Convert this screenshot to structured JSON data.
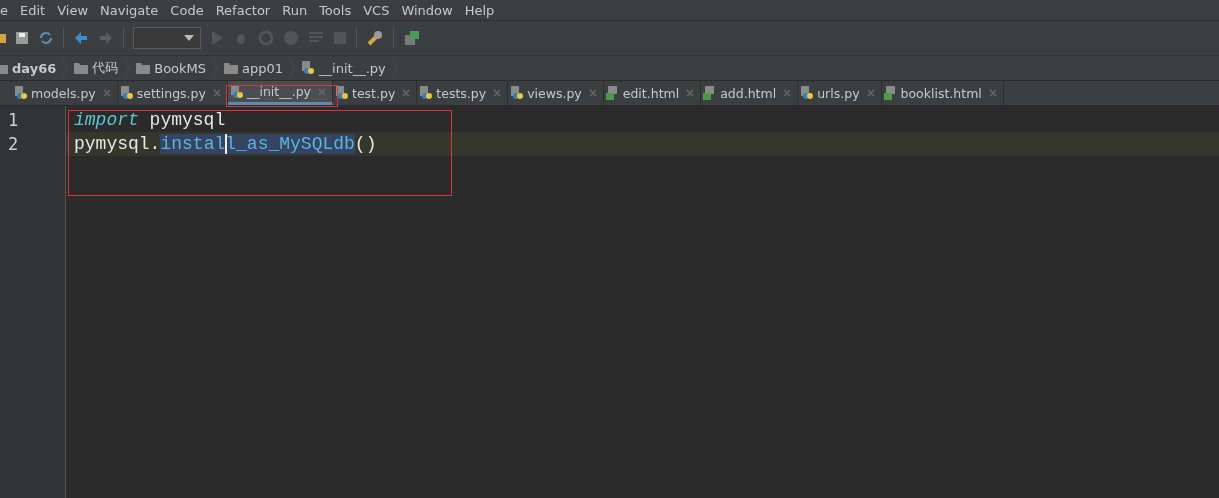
{
  "menu": [
    "e",
    "Edit",
    "View",
    "Navigate",
    "Code",
    "Refactor",
    "Run",
    "Tools",
    "VCS",
    "Window",
    "Help"
  ],
  "breadcrumbs": [
    {
      "label": "day66",
      "kind": "project"
    },
    {
      "label": "代码",
      "kind": "folder"
    },
    {
      "label": "BookMS",
      "kind": "folder"
    },
    {
      "label": "app01",
      "kind": "folder"
    },
    {
      "label": "__init__.py",
      "kind": "python"
    }
  ],
  "tabs": [
    {
      "label": "models.py",
      "kind": "python",
      "selected": false
    },
    {
      "label": "settings.py",
      "kind": "python",
      "selected": false
    },
    {
      "label": "__init__.py",
      "kind": "python",
      "selected": true
    },
    {
      "label": "test.py",
      "kind": "python",
      "selected": false
    },
    {
      "label": "tests.py",
      "kind": "python",
      "selected": false
    },
    {
      "label": "views.py",
      "kind": "python",
      "selected": false
    },
    {
      "label": "edit.html",
      "kind": "html",
      "selected": false
    },
    {
      "label": "add.html",
      "kind": "html",
      "selected": false
    },
    {
      "label": "urls.py",
      "kind": "python",
      "selected": false
    },
    {
      "label": "booklist.html",
      "kind": "html",
      "selected": false
    }
  ],
  "editor": {
    "lines": [
      {
        "number": "1",
        "current": false,
        "tokens": [
          {
            "text": "import",
            "kind": "keyword"
          },
          {
            "text": " pymysql",
            "kind": "plain"
          }
        ]
      },
      {
        "number": "2",
        "current": true,
        "tokens": [
          {
            "text": "pymysql.",
            "kind": "plain"
          },
          {
            "text": "instal",
            "kind": "ref"
          },
          {
            "text": "l_as_MySQLdb",
            "kind": "ref",
            "caret": true
          },
          {
            "text": "()",
            "kind": "plain"
          }
        ]
      }
    ]
  }
}
